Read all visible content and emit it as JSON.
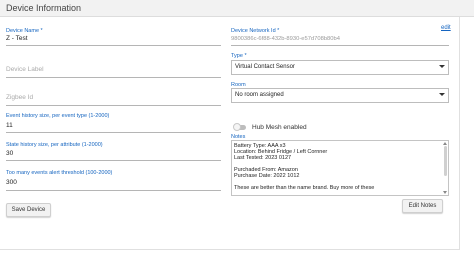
{
  "header": {
    "title": "Device Information"
  },
  "edit_link": "edit",
  "left": {
    "device_name": {
      "label": "Device Name *",
      "value": "Z - Test"
    },
    "device_label": {
      "placeholder": "Device Label"
    },
    "zigbee_id": {
      "placeholder": "Zigbee Id"
    },
    "event_history": {
      "label": "Event history size, per event type (1-2000)",
      "value": "11"
    },
    "state_history": {
      "label": "State history size, per attribute (1-2000)",
      "value": "30"
    },
    "events_alert": {
      "label": "Too many events alert threshold (100-2000)",
      "value": "300"
    },
    "save_button": "Save Device"
  },
  "right": {
    "network_id": {
      "label": "Device Network Id *",
      "value": "9800386c-6f88-432b-8930-e57d708b80b4"
    },
    "type": {
      "label": "Type *",
      "value": "Virtual Contact Sensor"
    },
    "room": {
      "label": "Room",
      "value": "No room assigned"
    },
    "hub_mesh": {
      "label": "Hub Mesh enabled",
      "enabled": false
    },
    "notes": {
      "label": "Notes",
      "lines": [
        "Battery Type: AAA x3",
        "Location: Behind Fridge / Left Cornner",
        "Last Tested: 2023 0127",
        "",
        "Purchaded From: Amazon",
        "Purchase Date: 2022 1012",
        "",
        "These are better than the name brand. Buy more of these"
      ]
    },
    "edit_notes_button": "Edit Notes"
  }
}
